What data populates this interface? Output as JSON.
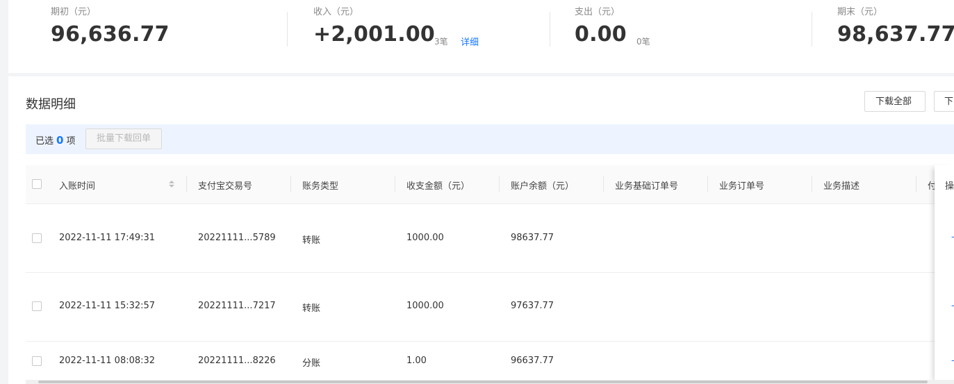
{
  "summary": {
    "opening": {
      "label": "期初（元）",
      "value": "96,636.77"
    },
    "income": {
      "label": "收入（元）",
      "value": "+2,001.00",
      "count": "3笔",
      "detail": "详细"
    },
    "expense": {
      "label": "支出（元）",
      "value": "0.00",
      "count": "0笔"
    },
    "closing": {
      "label": "期末（元）",
      "value": "98,637.77"
    }
  },
  "section": {
    "title": "数据明细",
    "download_all": "下载全部",
    "download_other": "下"
  },
  "selection": {
    "prefix": "已选",
    "count": "0",
    "suffix": "项",
    "batch_button": "批量下载回单"
  },
  "table": {
    "columns": [
      "入账时间",
      "支付宝交易号",
      "账务类型",
      "收支金额（元）",
      "账户余额（元）",
      "业务基础订单号",
      "业务订单号",
      "业务描述",
      "付",
      "操"
    ],
    "rows": [
      {
        "time": "2022-11-11 17:49:31",
        "trade_no": "20221111...5789",
        "type": "转账",
        "amount": "1000.00",
        "balance": "98637.77",
        "op": "-"
      },
      {
        "time": "2022-11-11 15:32:57",
        "trade_no": "20221111...7217",
        "type": "转账",
        "amount": "1000.00",
        "balance": "97637.77",
        "op": "-"
      },
      {
        "time": "2022-11-11 08:08:32",
        "trade_no": "20221111...8226",
        "type": "分账",
        "amount": "1.00",
        "balance": "96637.77",
        "op": "-"
      }
    ]
  }
}
